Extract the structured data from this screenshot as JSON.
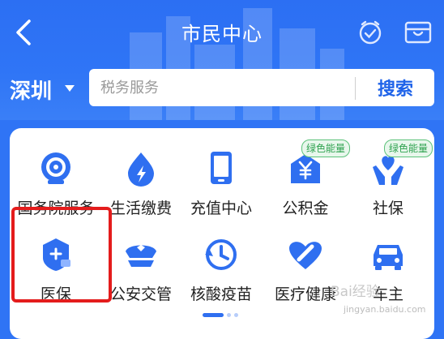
{
  "header": {
    "title": "市民中心",
    "back_icon": "chevron-left-icon",
    "timer_icon": "stopwatch-check-icon",
    "wallet_icon": "wallet-icon"
  },
  "location": {
    "city": "深圳",
    "caret_icon": "caret-down-icon"
  },
  "search": {
    "placeholder": "税务服务",
    "button_label": "搜索"
  },
  "services": [
    {
      "label": "国务院服务",
      "icon": "state-council-globe-icon",
      "badge": ""
    },
    {
      "label": "生活缴费",
      "icon": "water-drop-bolt-icon",
      "badge": ""
    },
    {
      "label": "充值中心",
      "icon": "phone-icon",
      "badge": ""
    },
    {
      "label": "公积金",
      "icon": "yen-house-icon",
      "badge": "绿色能量"
    },
    {
      "label": "社保",
      "icon": "hands-heart-icon",
      "badge": "绿色能量"
    },
    {
      "label": "医保",
      "icon": "medical-shield-icon",
      "badge": ""
    },
    {
      "label": "公安交管",
      "icon": "police-cap-icon",
      "badge": ""
    },
    {
      "label": "核酸疫苗",
      "icon": "clock-history-icon",
      "badge": ""
    },
    {
      "label": "医疗健康",
      "icon": "heart-bandage-icon",
      "badge": ""
    },
    {
      "label": "车主",
      "icon": "car-icon",
      "badge": ""
    }
  ],
  "pager": {
    "pages": 3,
    "active": 0
  },
  "watermark": {
    "line1": "Bai经验",
    "line2": "jingyan.baidu.com"
  },
  "colors": {
    "header_blue": "#2f74f5",
    "icon_blue": "#2f6ff0",
    "highlight_red": "#e41c1c",
    "badge_green": "#2ea24f"
  }
}
